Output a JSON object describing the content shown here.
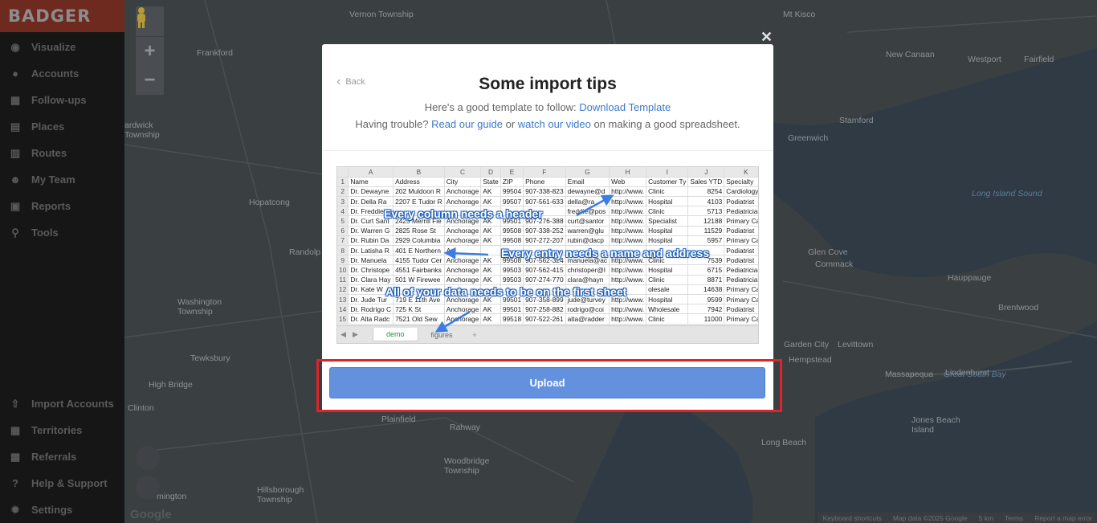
{
  "sidebar": {
    "logo": "BADGER",
    "items": [
      {
        "label": "Visualize",
        "icon": "eye-icon"
      },
      {
        "label": "Accounts",
        "icon": "user-circle-icon"
      },
      {
        "label": "Follow-ups",
        "icon": "calendar-icon"
      },
      {
        "label": "Places",
        "icon": "store-icon"
      },
      {
        "label": "Routes",
        "icon": "map-icon"
      },
      {
        "label": "My Team",
        "icon": "team-icon"
      },
      {
        "label": "Reports",
        "icon": "report-icon"
      },
      {
        "label": "Tools",
        "icon": "pin-icon"
      }
    ],
    "bottom_items": [
      {
        "label": "Import Accounts",
        "icon": "upload-icon"
      },
      {
        "label": "Territories",
        "icon": "grid-icon"
      },
      {
        "label": "Referrals",
        "icon": "gift-icon"
      },
      {
        "label": "Help & Support",
        "icon": "question-icon"
      },
      {
        "label": "Settings",
        "icon": "gear-icon"
      }
    ]
  },
  "map": {
    "labels": [
      "Vernon Township",
      "Frankford",
      "Mt Kisco",
      "New Canaan",
      "Westport",
      "Fairfield",
      "ardwick\nTownship",
      "Stamford",
      "Greenwich",
      "Hopatcong",
      "Randolp",
      "Washington\nTownship",
      "Glen Cove",
      "Commack",
      "Brentwood",
      "Tewksbury",
      "Hauppauge",
      "High Bridge",
      "Garden City",
      "Levittown",
      "Hempstead",
      "Massapequa",
      "Lindenhurst",
      "Clinton",
      "Plainfield",
      "Rahway",
      "Long Beach",
      "Jones Beach\nIsland",
      "Woodbridge\nTownship",
      "mington",
      "Hillsborough\nTownship"
    ],
    "water_labels": [
      "Great South Bay",
      "Long Island Sound"
    ],
    "zoom_in": "+",
    "zoom_out": "−",
    "google": "Google",
    "footer": [
      "Keyboard shortcuts",
      "Map data ©2025 Google",
      "5 km",
      "Terms",
      "Report a map error"
    ]
  },
  "modal": {
    "close": "✕",
    "back": "Back",
    "title": "Some import tips",
    "line1_prefix": "Here's a good template to follow: ",
    "line1_link": "Download Template",
    "line2_prefix": "Having trouble? ",
    "line2_link1": "Read our guide",
    "line2_mid": " or ",
    "line2_link2": "watch our video",
    "line2_suffix": " on making a good spreadsheet.",
    "sheet": {
      "col_letters": [
        "",
        "A",
        "B",
        "C",
        "D",
        "E",
        "F",
        "G",
        "H",
        "I",
        "J",
        "K"
      ],
      "header": [
        "Name",
        "Address",
        "City",
        "State",
        "ZIP",
        "Phone",
        "Email",
        "Web",
        "Customer Ty",
        "Sales YTD",
        "Specialty"
      ],
      "rows": [
        [
          "Dr. Dewayne",
          "202 Muldoon R",
          "Anchorage",
          "AK",
          "99504",
          "907-338-823",
          "dewayne@d",
          "http://www.",
          "Clinic",
          "8254",
          "Cardiology"
        ],
        [
          "Dr. Della Ra",
          "2207 E Tudor R",
          "Anchorage",
          "AK",
          "99507",
          "907-561-633",
          "della@ra",
          "http://www.",
          "Hospital",
          "4103",
          "Podiatrist"
        ],
        [
          "Dr. Freddie",
          "",
          "",
          "",
          "",
          "",
          "freddie@pos",
          "http://www.",
          "Clinic",
          "5713",
          "Pediatrician"
        ],
        [
          "Dr. Curt Sant",
          "2425 Merrill Fie",
          "Anchorage",
          "AK",
          "99501",
          "907-276-388",
          "curt@santor",
          "http://www.",
          "Specialist",
          "12188",
          "Primary Care"
        ],
        [
          "Dr. Warren G",
          "2825 Rose St",
          "Anchorage",
          "AK",
          "99508",
          "907-338-252",
          "warren@glu",
          "http://www.",
          "Hospital",
          "11529",
          "Podiatrist"
        ],
        [
          "Dr. Rubin Da",
          "2929 Columbia",
          "Anchorage",
          "AK",
          "99508",
          "907-272-207",
          "rubin@dacp",
          "http://www.",
          "Hospital",
          "5957",
          "Primary Care"
        ],
        [
          "Dr. Latisha R",
          "401 E Northern",
          "Av",
          "",
          "",
          "",
          "",
          "",
          "",
          "",
          "Podiatrist"
        ],
        [
          "Dr. Manuela",
          "4155 Tudor Cer",
          "Anchorage",
          "AK",
          "99508",
          "907-562-324",
          "manuela@ac",
          "http://www.",
          "Clinic",
          "7539",
          "Podiatrist"
        ],
        [
          "Dr. Christope",
          "4551 Fairbanks",
          "Anchorage",
          "AK",
          "99503",
          "907-562-415",
          "christoper@l",
          "http://www.",
          "Hospital",
          "6715",
          "Pediatrician"
        ],
        [
          "Dr. Clara Hay",
          "501 W Firewee",
          "Anchorage",
          "AK",
          "99503",
          "907-274-770",
          "clara@hayn",
          "http://www.",
          "Clinic",
          "8871",
          "Pediatrician"
        ],
        [
          "Dr. Kate W",
          "",
          "",
          "",
          "",
          "",
          "",
          "",
          "olesale",
          "14638",
          "Primary Care"
        ],
        [
          "Dr. Jude Tur",
          "719 E 11th Ave",
          "Anchorage",
          "AK",
          "99501",
          "907-358-899",
          "jude@turvey",
          "http://www.",
          "Hospital",
          "9599",
          "Primary Care"
        ],
        [
          "Dr. Rodrigo C",
          "725 K St",
          "Anchorage",
          "AK",
          "99501",
          "907-258-882",
          "rodrigo@coi",
          "http://www.",
          "Wholesale",
          "7942",
          "Podiatrist"
        ],
        [
          "Dr. Alta Radc",
          "7521 Old Sew",
          "Anchorage",
          "AK",
          "99518",
          "907-522-261",
          "alta@radder",
          "http://www.",
          "Clinic",
          "11000",
          "Primary Care"
        ]
      ],
      "tabs": [
        "demo",
        "figures"
      ],
      "add_tab": "+",
      "annotations": [
        "Every column needs a header",
        "Every entry needs a name and address",
        "All of your data needs to be on the first sheet"
      ]
    },
    "upload": "Upload"
  }
}
